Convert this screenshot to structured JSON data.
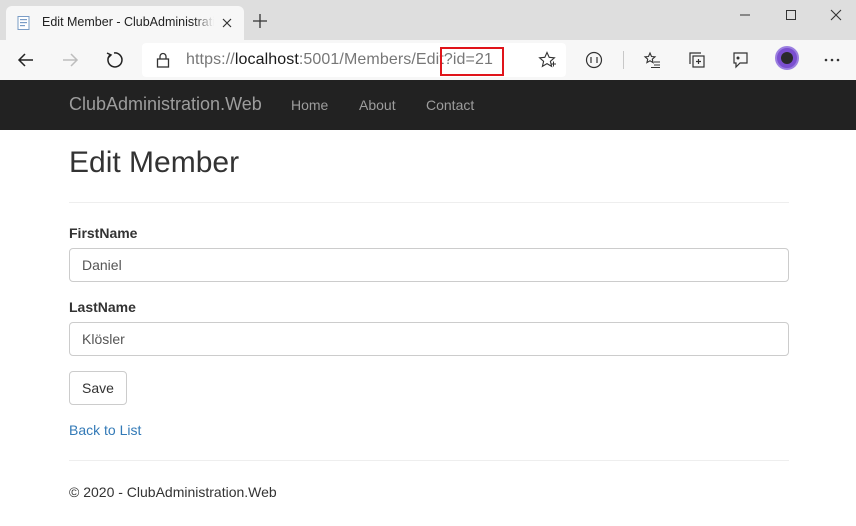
{
  "browser": {
    "tab_title": "Edit Member - ClubAdministration.Web",
    "url_prefix": "https://",
    "url_host": "localhost",
    "url_path": ":5001/Members/Edit?id=21"
  },
  "navbar": {
    "brand": "ClubAdministration.Web",
    "links": [
      "Home",
      "About",
      "Contact"
    ]
  },
  "page": {
    "title": "Edit Member"
  },
  "form": {
    "first_name_label": "FirstName",
    "first_name_value": "Daniel",
    "last_name_label": "LastName",
    "last_name_value": "Klösler",
    "save_label": "Save"
  },
  "back_link": "Back to List",
  "footer": "© 2020 - ClubAdministration.Web",
  "colors": {
    "navbar_bg": "#222222",
    "link": "#337ab7",
    "url_highlight": "#e0141a"
  },
  "icons": [
    "page-favicon-icon",
    "close-icon",
    "plus-icon",
    "minimize-icon",
    "maximize-icon",
    "window-close-icon",
    "back-arrow-icon",
    "forward-arrow-icon",
    "refresh-icon",
    "lock-icon",
    "star-icon",
    "reader-icon",
    "favorites-icon",
    "collections-icon",
    "feedback-icon",
    "more-icon"
  ]
}
